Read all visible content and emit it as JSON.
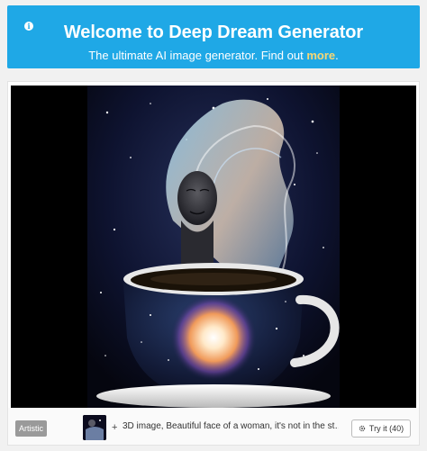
{
  "banner": {
    "info_icon": "i",
    "title": "Welcome to Deep Dream Generator",
    "subtitle_prefix": "The ultimate AI image generator. Find out ",
    "subtitle_link": "more",
    "subtitle_suffix": ".",
    "background": "#1fa8e6",
    "link_color": "#f7d774"
  },
  "card": {
    "image": {
      "icon": "galaxy-coffee-cup-artwork"
    },
    "tag": "Artistic",
    "plus": "+",
    "prompt": "3D image, Beautiful face of a woman, it's not in the st…",
    "try_button": "Try it (40)",
    "try_icon": "gear-icon"
  }
}
